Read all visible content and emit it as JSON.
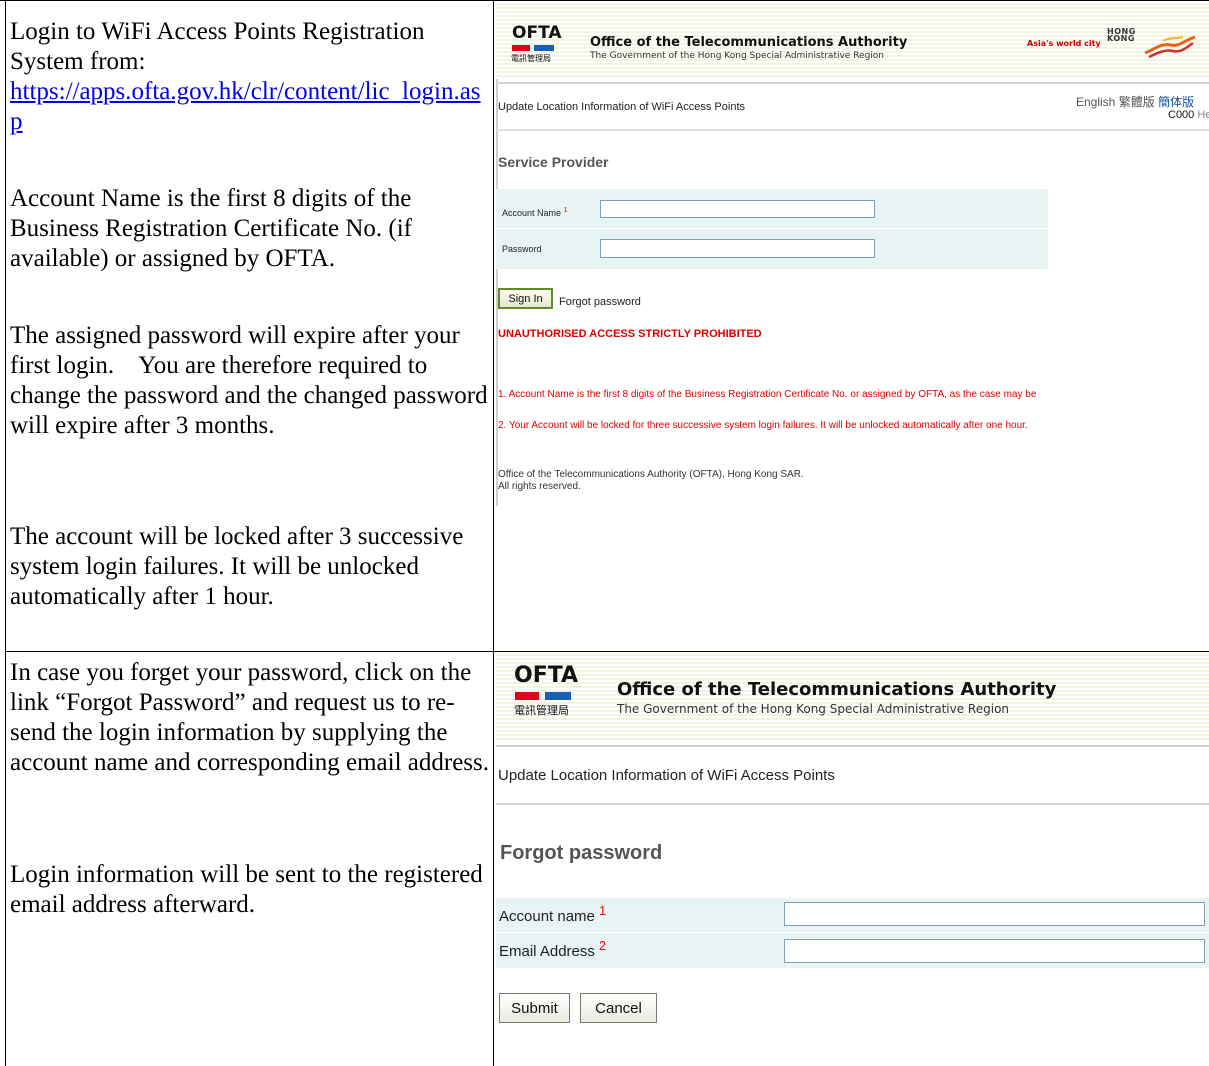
{
  "left": {
    "p1_text": "Login to WiFi Access Points Registration System from:",
    "p1_link": "https://apps.ofta.gov.hk/clr/content/lic_login.asp",
    "p2": "Account Name is the first 8 digits of the Business Registration Certificate No. (if available) or assigned by OFTA.",
    "p3": "The assigned password will expire after your first login.    You are therefore required to change the password and the changed password will expire after 3 months.",
    "p4": "The account will be locked after 3 successive system login failures. It will be unlocked automatically after 1 hour.",
    "p5": "In case you forget your password, click on the link “Forgot Password” and request us to re-send the login information by supplying the account name and corresponding email address.",
    "p6": "Login information will be sent to the registered email address afterward."
  },
  "header": {
    "logo": "OFTA",
    "logo_cjk": "電訊管理局",
    "org_title": "Office of the Telecommunications Authority",
    "org_sub": "The Government of the Hong Kong Special Administrative Region",
    "slogan": "Asia's world city",
    "hk_line1": "HONG",
    "hk_line2": "KONG"
  },
  "login": {
    "page_sub": "Update Location Information of WiFi Access Points",
    "lang_en": "English",
    "lang_tc": "繁體版",
    "lang_sc": "簡体版",
    "code": "C000",
    "help": "Help",
    "section_title": "Service Provider",
    "account_label": "Account Name",
    "account_sup": "1",
    "password_label": "Password",
    "account_value": "",
    "password_value": "",
    "sign_in": "Sign In",
    "forgot": "Forgot password",
    "warning": "UNAUTHORISED ACCESS STRICTLY PROHIBITED",
    "note1": "1. Account Name is the first 8 digits of the Business Registration Certificate No. or assigned by OFTA, as the case may be",
    "note2": "2. Your Account will be locked for three successive system login failures. It will be unlocked automatically after one hour.",
    "footer1": "Office of the Telecommunications Authority (OFTA), Hong Kong SAR.",
    "footer2": "All rights reserved."
  },
  "forgot": {
    "page_sub": "Update Location Information of WiFi Access Points",
    "section_title": "Forgot password",
    "account_label": "Account name",
    "account_sup": "1",
    "email_label": "Email Address",
    "email_sup": "2",
    "account_value": "",
    "email_value": "",
    "submit": "Submit",
    "cancel": "Cancel"
  },
  "colors": {
    "form_bg": "#e8f4f4",
    "warning_red": "#e00000",
    "link_blue": "#0000ee",
    "button_border_green": "#5f8c24"
  }
}
